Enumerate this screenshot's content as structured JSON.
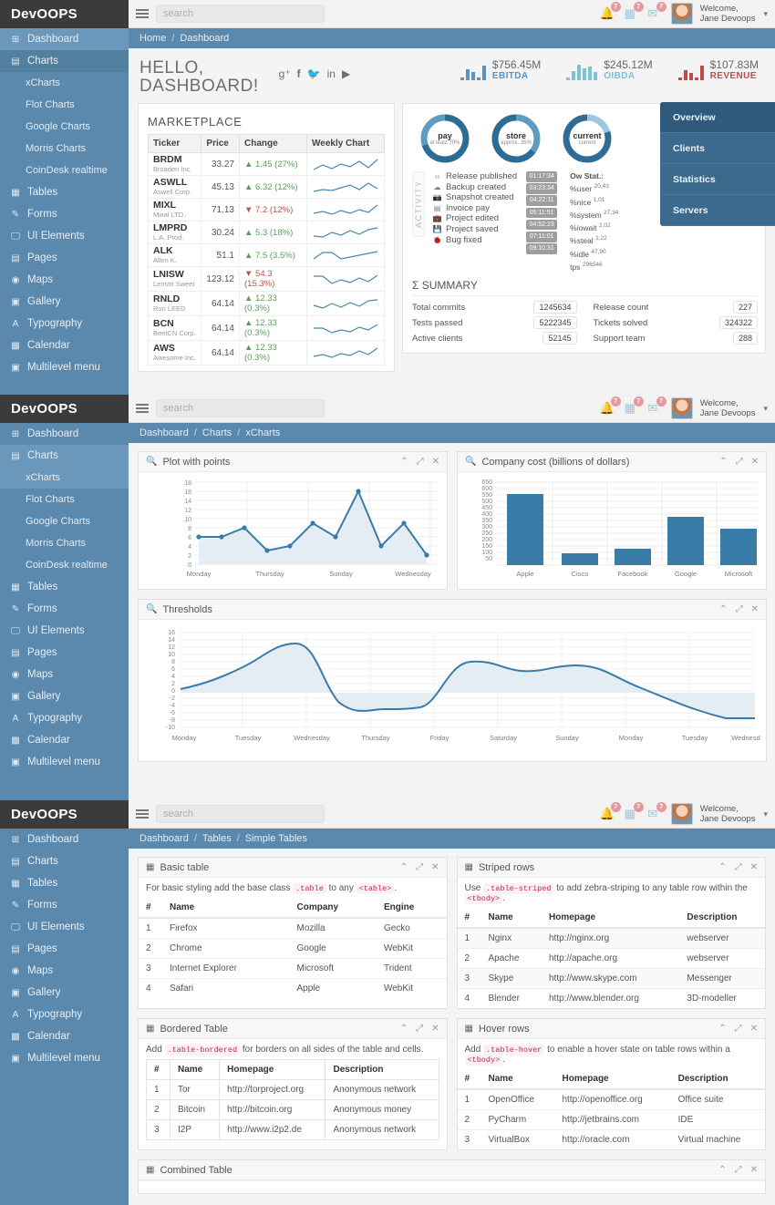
{
  "brand": "DevOOPS",
  "search": {
    "placeholder": "search"
  },
  "user": {
    "greeting": "Welcome,",
    "name": "Jane Devoops"
  },
  "notifications": {
    "bell": "7",
    "calendar": "7",
    "mail": "7"
  },
  "sidebar": {
    "items": [
      {
        "label": "Dashboard",
        "icon": "dashboard-icon"
      },
      {
        "label": "Charts",
        "icon": "charts-icon"
      },
      {
        "label": "Tables",
        "icon": "tables-icon"
      },
      {
        "label": "Forms",
        "icon": "forms-icon"
      },
      {
        "label": "UI Elements",
        "icon": "ui-elements-icon"
      },
      {
        "label": "Pages",
        "icon": "pages-icon"
      },
      {
        "label": "Maps",
        "icon": "maps-icon"
      },
      {
        "label": "Gallery",
        "icon": "gallery-icon"
      },
      {
        "label": "Typography",
        "icon": "typography-icon"
      },
      {
        "label": "Calendar",
        "icon": "calendar-icon"
      },
      {
        "label": "Multilevel menu",
        "icon": "multilevel-menu-icon"
      }
    ],
    "charts_submenu": [
      "xCharts",
      "Flot Charts",
      "Google Charts",
      "Morris Charts",
      "CoinDesk realtime"
    ]
  },
  "panel1": {
    "breadcrumb": [
      "Home",
      "Dashboard"
    ],
    "hello_line1": "HELLO,",
    "hello_line2": "DASHBOARD!",
    "socials": [
      "g+",
      "f",
      "t",
      "in",
      "yt"
    ],
    "kpis": [
      {
        "value": "$756.45M",
        "label": "EBITDA",
        "color": "#5b93be"
      },
      {
        "value": "$245.12M",
        "label": "OIBDA",
        "color": "#7fc2d6"
      },
      {
        "value": "$107.83M",
        "label": "REVENUE",
        "color": "#bf4b4b"
      }
    ],
    "marketplace": {
      "title": "MARKETPLACE",
      "columns": [
        "Ticker",
        "Price",
        "Change",
        "Weekly Chart"
      ],
      "rows": [
        {
          "ticker": "BRDM",
          "company": "Broaden Inc.",
          "price": "33.27",
          "change": "1.45 (27%)",
          "dir": "up"
        },
        {
          "ticker": "ASWLL",
          "company": "Aswell Corp.",
          "price": "45.13",
          "change": "6.32 (12%)",
          "dir": "up"
        },
        {
          "ticker": "MIXL",
          "company": "Mixal LTD.",
          "price": "71.13",
          "change": "7.2 (12%)",
          "dir": "down"
        },
        {
          "ticker": "LMPRD",
          "company": "L.A. Prod.",
          "price": "30.24",
          "change": "5.3 (18%)",
          "dir": "up"
        },
        {
          "ticker": "ALK",
          "company": "Allen K.",
          "price": "51.1",
          "change": "7.5 (3.5%)",
          "dir": "up"
        },
        {
          "ticker": "LNISW",
          "company": "Lenstri Sweet",
          "price": "123.12",
          "change": "54.3 (15.3%)",
          "dir": "down"
        },
        {
          "ticker": "RNLD",
          "company": "Ron LEED",
          "price": "64.14",
          "change": "12.33 (0.3%)",
          "dir": "up"
        },
        {
          "ticker": "BCN",
          "company": "BeetCN Corp.",
          "price": "64.14",
          "change": "12.33 (0.3%)",
          "dir": "up"
        },
        {
          "ticker": "AWS",
          "company": "Awesome Inc.",
          "price": "64.14",
          "change": "12.33 (0.3%)",
          "dir": "up"
        }
      ]
    },
    "donuts": [
      {
        "title": "pay",
        "subtitle": "at least 70%",
        "percent": 70
      },
      {
        "title": "store",
        "subtitle": "approx. 35%",
        "percent": 35
      },
      {
        "title": "current",
        "subtitle": "current",
        "percent": 20
      }
    ],
    "activity": {
      "label": "ACTIVITY",
      "items": [
        {
          "icon": "code-icon",
          "text": "Release published",
          "time": "01:17:34"
        },
        {
          "icon": "cloud-icon",
          "text": "Backup created",
          "time": "03:23:34"
        },
        {
          "icon": "camera-icon",
          "text": "Snapshot created",
          "time": "04:22:11"
        },
        {
          "icon": "card-icon",
          "text": "Invoice pay",
          "time": "05:11:51"
        },
        {
          "icon": "briefcase-icon",
          "text": "Project edited",
          "time": "04:52:23"
        },
        {
          "icon": "save-icon",
          "text": "Project saved",
          "time": "07:11:01"
        },
        {
          "icon": "bug-icon",
          "text": "Bug fixed",
          "time": "09:10:31"
        }
      ]
    },
    "owstat": {
      "title": "Ow Stat.:",
      "rows": [
        {
          "k": "%user",
          "v": "20,43"
        },
        {
          "k": "%nice",
          "v": "1,01"
        },
        {
          "k": "%system",
          "v": "27,34"
        },
        {
          "k": "%iowait",
          "v": "2,02"
        },
        {
          "k": "%steal",
          "v": "1,22"
        },
        {
          "k": "%idle",
          "v": "47,90"
        },
        {
          "k": "tps",
          "v": "296546"
        }
      ]
    },
    "summary": {
      "title": "Σ SUMMARY",
      "left": [
        {
          "k": "Total commits",
          "v": "1245634"
        },
        {
          "k": "Tests passed",
          "v": "5222345"
        },
        {
          "k": "Active clients",
          "v": "52145"
        }
      ],
      "right": [
        {
          "k": "Release count",
          "v": "227"
        },
        {
          "k": "Tickets solved",
          "v": "324322"
        },
        {
          "k": "Support team",
          "v": "288"
        }
      ]
    },
    "side_tabs": [
      "Overview",
      "Clients",
      "Statistics",
      "Servers"
    ]
  },
  "panel2": {
    "breadcrumb": [
      "Dashboard",
      "Charts",
      "xCharts"
    ],
    "widgets": [
      "Plot with points",
      "Company cost (billions of dollars)",
      "Thresholds"
    ]
  },
  "panel3": {
    "breadcrumb": [
      "Dashboard",
      "Tables",
      "Simple Tables"
    ],
    "basic": {
      "title": "Basic table",
      "note_pre": "For basic styling add the base class ",
      "note_code1": ".table",
      "note_mid": " to any ",
      "note_code2": "<table>",
      "note_post": ".",
      "columns": [
        "#",
        "Name",
        "Company",
        "Engine"
      ],
      "rows": [
        [
          "1",
          "Firefox",
          "Mozilla",
          "Gecko"
        ],
        [
          "2",
          "Chrome",
          "Google",
          "WebKit"
        ],
        [
          "3",
          "Internet Explorer",
          "Microsoft",
          "Trident"
        ],
        [
          "4",
          "Safari",
          "Apple",
          "WebKit"
        ]
      ]
    },
    "striped": {
      "title": "Striped rows",
      "note_pre": "Use ",
      "note_code1": ".table-striped",
      "note_mid": " to add zebra-striping to any table row within the ",
      "note_code2": "<tbody>",
      "note_post": ".",
      "columns": [
        "#",
        "Name",
        "Homepage",
        "Description"
      ],
      "rows": [
        [
          "1",
          "Nginx",
          "http://nginx.org",
          "webserver"
        ],
        [
          "2",
          "Apache",
          "http://apache.org",
          "webserver"
        ],
        [
          "3",
          "Skype",
          "http://www.skype.com",
          "Messenger"
        ],
        [
          "4",
          "Blender",
          "http://www.blender.org",
          "3D-modeller"
        ]
      ]
    },
    "bordered": {
      "title": "Bordered Table",
      "note_pre": "Add ",
      "note_code1": ".table-bordered",
      "note_mid": " for borders on all sides of the table and cells.",
      "note_code2": "",
      "note_post": "",
      "columns": [
        "#",
        "Name",
        "Homepage",
        "Description"
      ],
      "rows": [
        [
          "1",
          "Tor",
          "http://torproject.org",
          "Anonymous network"
        ],
        [
          "2",
          "Bitcoin",
          "http://bitcoin.org",
          "Anonymous money"
        ],
        [
          "3",
          "I2P",
          "http://www.i2p2.de",
          "Anonymous network"
        ]
      ]
    },
    "hover": {
      "title": "Hover rows",
      "note_pre": "Add ",
      "note_code1": ".table-hover",
      "note_mid": " to enable a hover state on table rows within a ",
      "note_code2": "<tbody>",
      "note_post": ".",
      "columns": [
        "#",
        "Name",
        "Homepage",
        "Description"
      ],
      "rows": [
        [
          "1",
          "OpenOffice",
          "http://openoffice.org",
          "Office suite"
        ],
        [
          "2",
          "PyCharm",
          "http://jetbrains.com",
          "IDE"
        ],
        [
          "3",
          "VirtualBox",
          "http://oracle.com",
          "Virtual machine"
        ]
      ]
    },
    "combined": {
      "title": "Combined Table"
    }
  },
  "chart_data": [
    {
      "type": "line",
      "title": "Plot with points",
      "xlabel": "",
      "ylabel": "",
      "ylim": [
        0,
        18
      ],
      "yticks": [
        0,
        2,
        4,
        6,
        8,
        10,
        12,
        14,
        16,
        18
      ],
      "xtick_labels": [
        "Monday",
        "Thursday",
        "Sunday",
        "Wednesday"
      ],
      "x": [
        0,
        1,
        2,
        3,
        4,
        5,
        6,
        7,
        8,
        9,
        10,
        11,
        12
      ],
      "values": [
        6,
        6,
        8,
        3,
        4,
        9,
        6,
        16,
        4,
        9,
        2
      ],
      "markers": true,
      "grid": true,
      "legend": "none"
    },
    {
      "type": "bar",
      "title": "Company cost (billions of dollars)",
      "categories": [
        "Apple",
        "Cisco",
        "Facebook",
        "Google",
        "Microsoft"
      ],
      "values": [
        570,
        120,
        157,
        390,
        300
      ],
      "ylim": [
        50,
        650
      ],
      "yticks": [
        50,
        100,
        150,
        200,
        250,
        300,
        350,
        400,
        450,
        500,
        550,
        600,
        650
      ],
      "xlabel": "",
      "ylabel": "",
      "grid": true,
      "legend": "none"
    },
    {
      "type": "area",
      "title": "Thresholds",
      "ylim": [
        -10,
        16
      ],
      "yticks": [
        -10,
        -8,
        -6,
        -4,
        -2,
        0,
        2,
        4,
        6,
        8,
        10,
        12,
        14,
        16
      ],
      "xtick_labels": [
        "Monday",
        "Tuesday",
        "Wednesday",
        "Thursday",
        "Friday",
        "Saturday",
        "Sunday",
        "Monday",
        "Tuesday",
        "Wednesd"
      ],
      "values": [
        1,
        6,
        13,
        -3,
        -4.2,
        9.2,
        6,
        7,
        -2,
        -7
      ],
      "xlabel": "",
      "ylabel": "",
      "grid": true,
      "legend": "none"
    }
  ]
}
